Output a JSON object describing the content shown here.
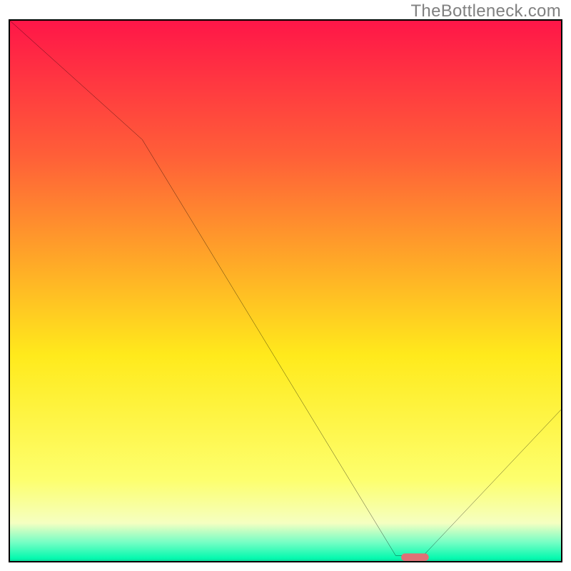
{
  "watermark": {
    "text": "TheBottleneck.com"
  },
  "chart_data": {
    "type": "line",
    "title": "",
    "xlabel": "",
    "ylabel": "",
    "xlim": [
      0,
      100
    ],
    "ylim": [
      0,
      100
    ],
    "x": [
      0,
      24,
      70,
      75,
      100
    ],
    "values": [
      100,
      78,
      1,
      1,
      28
    ],
    "marker": {
      "x_start": 71,
      "x_end": 76,
      "y": 0.5,
      "color": "#df7176"
    },
    "background_gradient": {
      "stops": [
        {
          "pct": 0,
          "color": "#ff1648"
        },
        {
          "pct": 25,
          "color": "#ff5f38"
        },
        {
          "pct": 44,
          "color": "#ffa628"
        },
        {
          "pct": 62,
          "color": "#ffea1c"
        },
        {
          "pct": 85,
          "color": "#fdff6e"
        },
        {
          "pct": 93,
          "color": "#f5ffc1"
        },
        {
          "pct": 96.5,
          "color": "#77fec5"
        },
        {
          "pct": 99.5,
          "color": "#06f9af"
        },
        {
          "pct": 100,
          "color": "#0adb9b"
        }
      ]
    }
  }
}
